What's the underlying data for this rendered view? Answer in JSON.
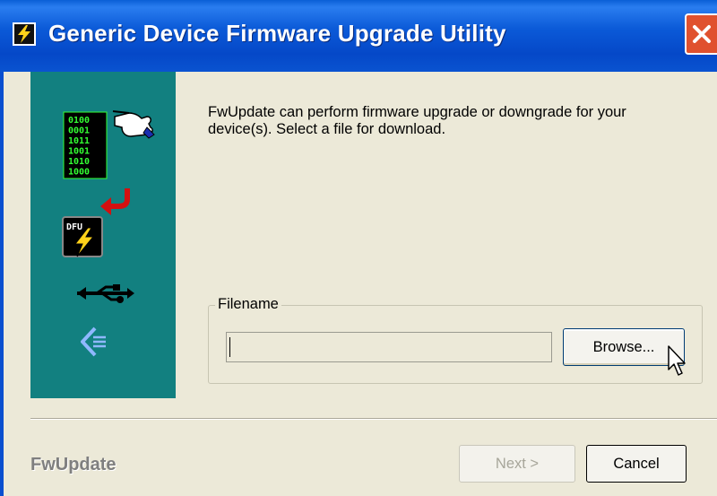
{
  "window": {
    "title": "Generic Device Firmware Upgrade Utility"
  },
  "icons": {
    "app": "lightning-bolt-icon",
    "close": "close-icon",
    "binary": "binary-data-icon",
    "hand": "hand-pointing-icon",
    "arrow": "red-return-arrow-icon",
    "chip": "dfu-chip-icon",
    "usb": "usb-icon",
    "back": "back-arrow-icon"
  },
  "binary_lines": [
    "0100",
    "0001",
    "1011",
    "1001",
    "1010",
    "1000"
  ],
  "chip_label": "DFU",
  "description": "FwUpdate can perform firmware upgrade or downgrade for your device(s). Select a file for download.",
  "filename_group": {
    "label": "Filename",
    "value": "",
    "browse_label": "Browse..."
  },
  "footer": {
    "label": "FwUpdate",
    "next_label": "Next >",
    "cancel_label": "Cancel"
  },
  "colors": {
    "titlebar": "#0a53d0",
    "sidepanel": "#128080",
    "close": "#e0512e",
    "dialog_bg": "#ece9d8"
  }
}
